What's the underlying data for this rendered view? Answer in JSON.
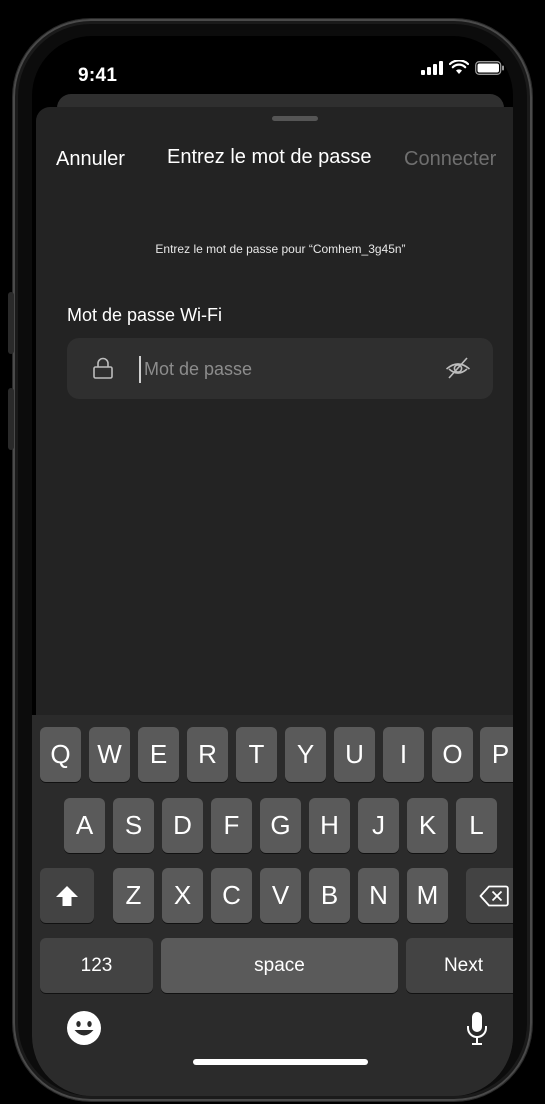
{
  "status_bar": {
    "time": "9:41"
  },
  "nav": {
    "cancel_label": "Annuler",
    "title": "Entrez le mot de passe",
    "connect_label": "Connecter"
  },
  "subtitle": "Entrez le mot de passe pour “Comhem_3g45n”",
  "password_field": {
    "label": "Mot de passe Wi-Fi",
    "placeholder": "Mot de passe",
    "value": ""
  },
  "keyboard": {
    "row1": [
      "Q",
      "W",
      "E",
      "R",
      "T",
      "Y",
      "U",
      "I",
      "O",
      "P"
    ],
    "row2": [
      "A",
      "S",
      "D",
      "F",
      "G",
      "H",
      "J",
      "K",
      "L"
    ],
    "row3": [
      "Z",
      "X",
      "C",
      "V",
      "B",
      "N",
      "M"
    ],
    "numbers_label": "123",
    "space_label": "space",
    "next_label": "Next"
  },
  "icons": {
    "shift": "shift-icon",
    "delete": "backspace-icon",
    "emoji": "emoji-icon",
    "mic": "microphone-icon",
    "lock": "lock-icon",
    "visibility": "eye-slash-icon"
  }
}
